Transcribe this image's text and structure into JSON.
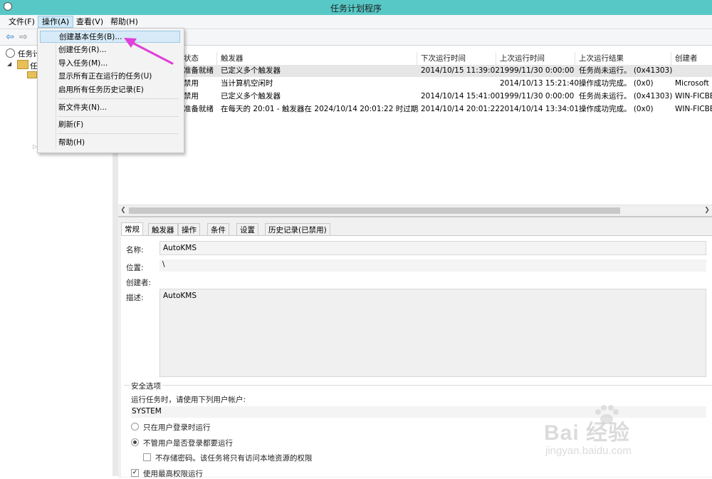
{
  "window": {
    "title": "任务计划程序"
  },
  "menu": {
    "file": "文件(F)",
    "action": "操作(A)",
    "view": "查看(V)",
    "help": "帮助(H)"
  },
  "tree": {
    "root_label": "任务计",
    "child_label": "任"
  },
  "list": {
    "columns": [
      "状态",
      "触发器",
      "下次运行时间",
      "上次运行时间",
      "上次运行结果",
      "创建者"
    ],
    "rows": [
      {
        "status": "准备就绪",
        "trigger": "已定义多个触发器",
        "next": "2014/10/15 11:39:02",
        "last": "1999/11/30 0:00:00",
        "result": "任务尚未运行。 (0x41303)",
        "author": ""
      },
      {
        "status": "禁用",
        "trigger": "当计算机空闲时",
        "next": "",
        "last": "2014/10/13 15:21:40",
        "result": "操作成功完成。 (0x0)",
        "author": "Microsoft"
      },
      {
        "status": "禁用",
        "trigger": "已定义多个触发器",
        "next": "2014/10/14 15:41:00",
        "last": "1999/11/30 0:00:00",
        "result": "任务尚未运行。 (0x41303)",
        "author": "WIN-FICBE"
      },
      {
        "status": "准备就绪",
        "trigger": "在每天的 20:01 - 触发器在 2024/10/14 20:01:22 时过期。",
        "next": "2014/10/14 20:01:22",
        "last": "2014/10/14 13:34:01",
        "result": "操作成功完成。 (0x0)",
        "author": "WIN-FICBE"
      }
    ]
  },
  "tabs": [
    "常规",
    "触发器",
    "操作",
    "条件",
    "设置",
    "历史记录(已禁用)"
  ],
  "general": {
    "name_label": "名称:",
    "name_value": "AutoKMS",
    "location_label": "位置:",
    "location_value": "\\",
    "author_label": "创建者:",
    "desc_label": "描述:",
    "desc_value": "AutoKMS"
  },
  "security": {
    "title": "安全选项",
    "run_as_label": "运行任务时，请使用下列用户帐户:",
    "account": "SYSTEM",
    "opt_logged_on": "只在用户登录时运行",
    "opt_any": "不管用户是否登录都要运行",
    "no_store_pwd": "不存储密码。该任务将只有访问本地资源的权限",
    "highest": "使用最高权限运行"
  },
  "dropdown": {
    "items": [
      "创建基本任务(B)...",
      "创建任务(R)...",
      "导入任务(M)...",
      "显示所有正在运行的任务(U)",
      "启用所有任务历史记录(E)",
      "新文件夹(N)...",
      "刷新(F)",
      "帮助(H)"
    ]
  },
  "watermark": {
    "brand": "Bai  经验",
    "url": "jingyan.baidu.com"
  },
  "colors": {
    "titlebar": "#57c8c6",
    "highlight": "#d7eaf8",
    "arrow": "#e040d8"
  }
}
